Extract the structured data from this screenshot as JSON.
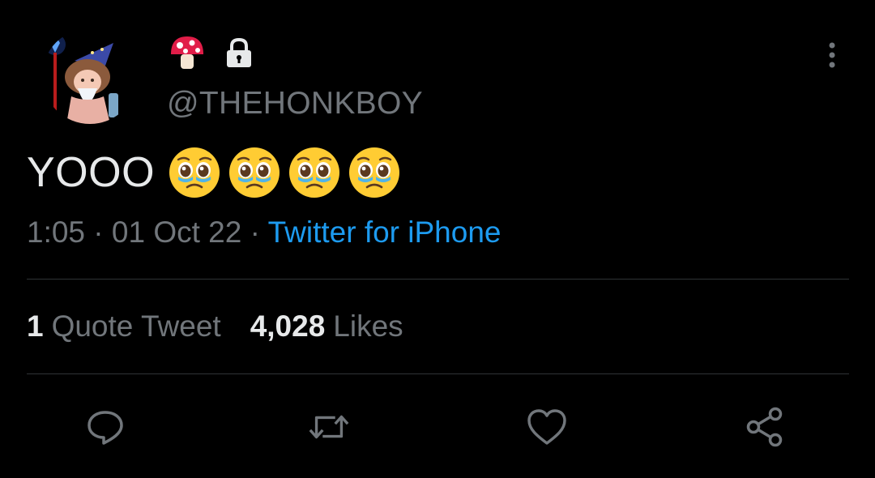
{
  "tweet": {
    "display_name_emoji": "🍄",
    "protected_icon": "lock-icon",
    "handle": "@THEHONKBOY",
    "text": "YOOO",
    "emojis": [
      "🥹",
      "🥹",
      "🥹",
      "🥹"
    ],
    "time": "1:05",
    "date": "01 Oct 22",
    "separator": "·",
    "source": "Twitter for iPhone",
    "more_icon": "more-vertical-icon"
  },
  "stats": {
    "quote_count": "1",
    "quote_label": "Quote Tweet",
    "likes_count": "4,028",
    "likes_label": "Likes"
  },
  "actions": {
    "reply": "reply-icon",
    "retweet": "retweet-icon",
    "like": "like-icon",
    "share": "share-icon"
  },
  "colors": {
    "background": "#000000",
    "text_primary": "#e7e9ea",
    "text_secondary": "#71767b",
    "link": "#1d9bf0",
    "divider": "#2f3336"
  }
}
